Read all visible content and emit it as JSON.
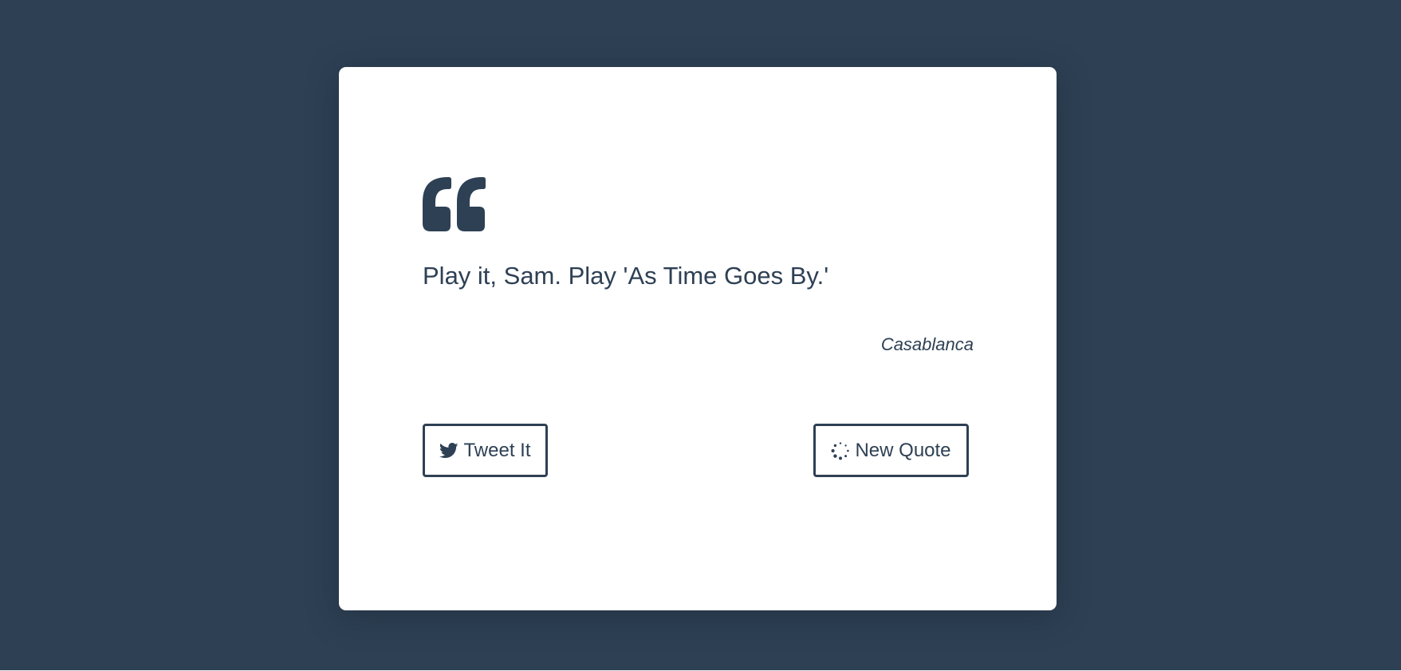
{
  "colors": {
    "background": "#2e4054",
    "card": "#ffffff",
    "accent": "#2e4054"
  },
  "quote": {
    "icon": "quote-left-icon",
    "text": "Play it, Sam. Play 'As Time Goes By.'",
    "author": "Casablanca"
  },
  "buttons": {
    "tweet": {
      "label": "Tweet It",
      "icon": "twitter-icon"
    },
    "new_quote": {
      "label": "New Quote",
      "icon": "spinner-icon"
    }
  }
}
